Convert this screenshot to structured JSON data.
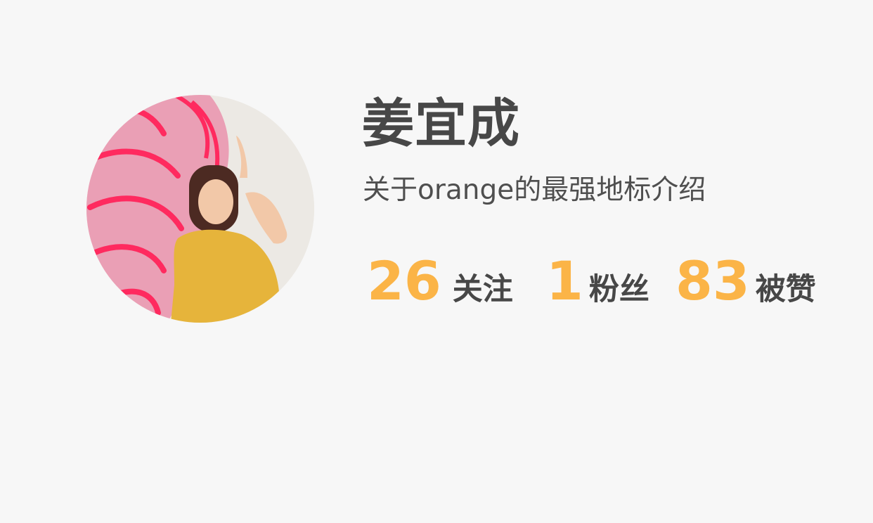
{
  "profile": {
    "avatar_icon": "avatar-photo",
    "name": "姜宜成",
    "bio": "关于orange的最强地标介绍"
  },
  "stats": [
    {
      "count": "26",
      "label": "关注"
    },
    {
      "count": "1",
      "label": "粉丝"
    },
    {
      "count": "83",
      "label": "被赞"
    }
  ],
  "colors": {
    "background": "#f7f7f7",
    "text": "#474747",
    "accent": "#fbb447"
  }
}
